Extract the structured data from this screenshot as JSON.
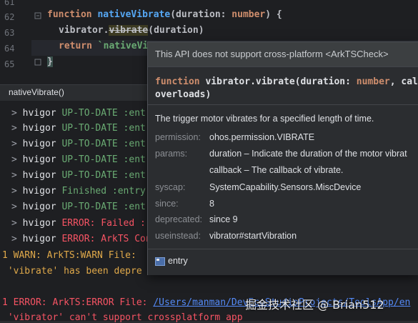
{
  "editor": {
    "line_numbers": [
      "61",
      "62",
      "63",
      "64",
      "65"
    ],
    "lines": [
      {
        "kw": "function ",
        "fn": "nativeVibrate",
        "rest": "(duration: ",
        "type": "number",
        "end": ") {"
      },
      {
        "obj": "vibrator.",
        "method": "vibrate",
        "args": "(duration)"
      },
      {
        "kw": "return ",
        "str": "`nativeVi"
      },
      {
        "brace": "}"
      }
    ]
  },
  "breadcrumb": "nativeVibrate()",
  "console": {
    "lines": [
      {
        "arrow": ">",
        "name": "hvigor",
        "status": "UP-TO-DATE :ent",
        "color": "green"
      },
      {
        "arrow": ">",
        "name": "hvigor",
        "status": "UP-TO-DATE :ent",
        "color": "green"
      },
      {
        "arrow": ">",
        "name": "hvigor",
        "status": "UP-TO-DATE :ent",
        "color": "green"
      },
      {
        "arrow": ">",
        "name": "hvigor",
        "status": "UP-TO-DATE :ent",
        "color": "green"
      },
      {
        "arrow": ">",
        "name": "hvigor",
        "status": "Finished :entry",
        "color": "green"
      },
      {
        "arrow": ">",
        "name": "hvigor",
        "status": "UP-TO-DATE :ent",
        "color": "green"
      },
      {
        "arrow": ">",
        "name": "hvigor",
        "status": "ERROR: Failed :",
        "color": "red"
      },
      {
        "arrow": ">",
        "name": "hvigor",
        "status": "ERROR: ArkTS Con",
        "color": "red"
      }
    ],
    "warn_line": "1 WARN: ArkTS:WARN File: ",
    "warn_detail": " 'vibrate' has been depre",
    "error_line_prefix": "1 ERROR: ArkTS:ERROR File: ",
    "error_path": "/Users/manman/DevEcoStudioProjects/ToolsApp/en",
    "error_detail": " 'vibrator' can't support crossplatform app"
  },
  "popup": {
    "warning": "This API does not support cross-platform <ArkTSCheck>",
    "signature_kw": "function ",
    "signature_fn": "vibrator.vibrate",
    "signature_args_a": "(duration: ",
    "signature_type": "number",
    "signature_args_b": ", cal",
    "signature_line2": "overloads)",
    "description": "The trigger motor vibrates for a specified length of time.",
    "fields": [
      {
        "key": "permission:",
        "value": "ohos.permission.VIBRATE"
      },
      {
        "key": "params:",
        "value": "duration – Indicate the duration of the motor vibrat"
      },
      {
        "key": "",
        "value": "callback – The callback of vibrate."
      },
      {
        "key": "syscap:",
        "value": "SystemCapability.Sensors.MiscDevice"
      },
      {
        "key": "since:",
        "value": "8"
      },
      {
        "key": "deprecated:",
        "value": "since 9"
      },
      {
        "key": "useinstead:",
        "value": "vibrator#startVibration"
      }
    ],
    "footer_module": "entry"
  },
  "watermark": "掘金技术社区 @ Brian512"
}
